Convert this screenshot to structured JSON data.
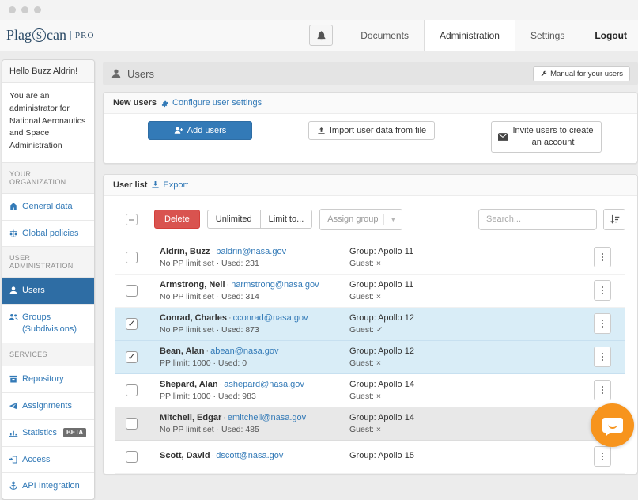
{
  "navbar": {
    "logo": {
      "plag": "Plag",
      "s": "S",
      "can": "can",
      "pro": "PRO"
    },
    "items": [
      {
        "label": "Documents"
      },
      {
        "label": "Administration"
      },
      {
        "label": "Settings"
      },
      {
        "label": "Logout"
      }
    ]
  },
  "sidebar": {
    "greeting": "Hello Buzz Aldrin!",
    "description": "You are an administrator for National Aeronautics and Space Administration",
    "sections": {
      "your_organization": "YOUR ORGANIZATION",
      "user_administration": "USER ADMINISTRATION",
      "services": "SERVICES"
    },
    "items": {
      "general_data": "General data",
      "global_policies": "Global policies",
      "users": "Users",
      "groups": "Groups (Subdivisions)",
      "repository": "Repository",
      "assignments": "Assignments",
      "statistics": "Statistics",
      "statistics_badge": "BETA",
      "access": "Access",
      "api_integration": "API Integration"
    }
  },
  "main": {
    "header": {
      "title": "Users",
      "manual_button": "Manual for your users"
    },
    "new_users": {
      "title": "New users",
      "configure_link": "Configure user settings",
      "add_users_button": "Add users",
      "import_button": "Import user data from file",
      "invite_button": "Invite users to create an account"
    },
    "user_list": {
      "title": "User list",
      "export_link": "Export",
      "sep": "·",
      "toolbar": {
        "delete_button": "Delete",
        "unlimited_button": "Unlimited",
        "limit_button": "Limit to...",
        "assign_group_placeholder": "Assign group",
        "search_placeholder": "Search..."
      },
      "rows": [
        {
          "name": "Aldrin, Buzz",
          "email": "baldrin@nasa.gov",
          "usage": "No PP limit set · Used: 231",
          "group": "Group: Apollo 11",
          "guest": "Guest: ×",
          "check": ""
        },
        {
          "name": "Armstrong, Neil",
          "email": "narmstrong@nasa.gov",
          "usage": "No PP limit set · Used: 314",
          "group": "Group: Apollo 11",
          "guest": "Guest: ×",
          "check": ""
        },
        {
          "name": "Conrad, Charles",
          "email": "cconrad@nasa.gov",
          "usage": "No PP limit set · Used: 873",
          "group": "Group: Apollo 12",
          "guest": "Guest: ✓",
          "check": "✓"
        },
        {
          "name": "Bean, Alan",
          "email": "abean@nasa.gov",
          "usage": "PP limit: 1000 · Used: 0",
          "group": "Group: Apollo 12",
          "guest": "Guest: ×",
          "check": "✓"
        },
        {
          "name": "Shepard, Alan",
          "email": "ashepard@nasa.gov",
          "usage": "PP limit: 1000 · Used: 983",
          "group": "Group: Apollo 14",
          "guest": "Guest: ×",
          "check": ""
        },
        {
          "name": "Mitchell, Edgar",
          "email": "emitchell@nasa.gov",
          "usage": "No PP limit set · Used: 485",
          "group": "Group: Apollo 14",
          "guest": "Guest: ×",
          "check": ""
        },
        {
          "name": "Scott, David",
          "email": "dscott@nasa.gov",
          "usage": "",
          "group": "Group: Apollo 15",
          "guest": "",
          "check": ""
        }
      ]
    }
  },
  "colors": {
    "accent": "#337ab7",
    "active_sidebar": "#2e6da4",
    "delete": "#d9534f",
    "selected_row": "#d9edf7",
    "chat": "#f7941d"
  }
}
